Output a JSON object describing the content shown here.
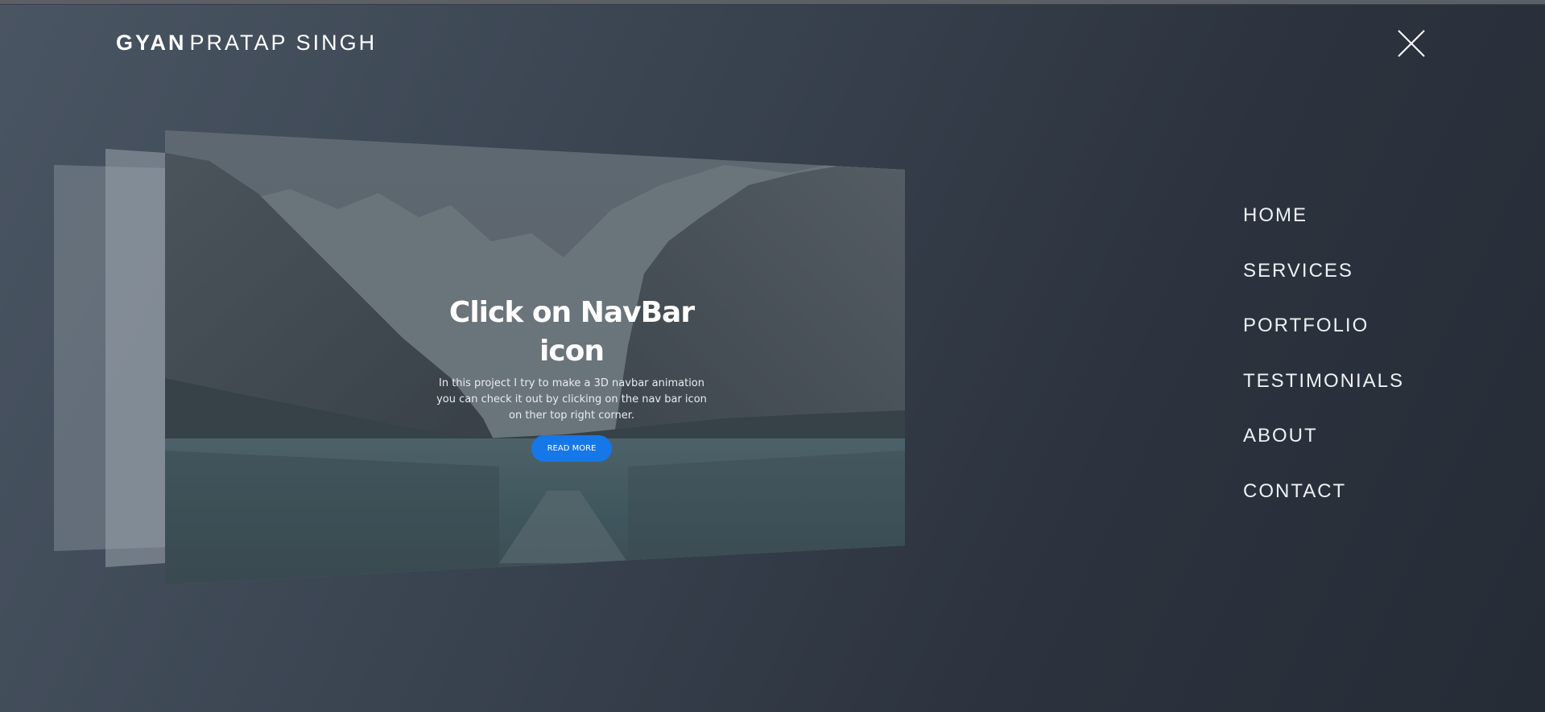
{
  "header": {
    "brand_first": "GYAN",
    "brand_rest": "PRATAP SINGH"
  },
  "close_icon": "close-icon",
  "hero": {
    "title": "Click on NavBar icon",
    "description": "In this project I try to make a 3D navbar animation you can check it out by clicking on the nav bar icon on ther top right corner.",
    "button_label": "READ MORE"
  },
  "nav": {
    "items": [
      "HOME",
      "SERVICES",
      "PORTFOLIO",
      "TESTIMONIALS",
      "ABOUT",
      "CONTACT"
    ]
  },
  "colors": {
    "accent": "#1677e8",
    "background_dark": "#262c36",
    "background_light": "#4a5563"
  }
}
